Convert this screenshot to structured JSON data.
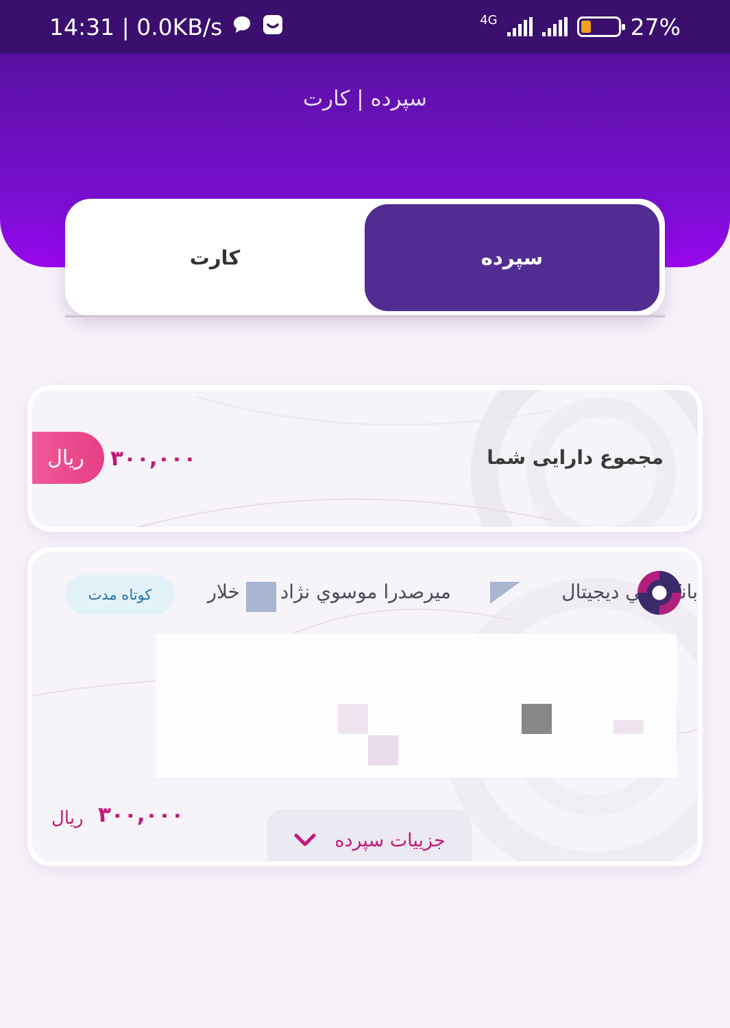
{
  "status_bar": {
    "time_speed": "14:31 | 0.0KB/s",
    "network_type": "4G",
    "battery_percent": "27%",
    "battery_level": 0.27
  },
  "header": {
    "title": "سپرده | کارت"
  },
  "tabs": [
    {
      "label": "سپرده",
      "active": true
    },
    {
      "label": "کارت",
      "active": false
    }
  ],
  "total_assets": {
    "label": "مجموع دارایی شما",
    "amount": "۳۰۰,۰۰۰",
    "currency": "ریال"
  },
  "deposit": {
    "bank_name": "بانک ملي ديجيتال",
    "owner_name": "ميرصدرا موسوي نژاد",
    "account_partial": "خلار",
    "type_badge": "کوتاه مدت",
    "amount": "۳۰۰,۰۰۰",
    "currency": "ریال",
    "details_label": "جزییات سپرده"
  },
  "colors": {
    "status_bar": "#3a0f6e",
    "header_top": "#5810a1",
    "header_bottom": "#9a07f0",
    "active_tab": "#512d92",
    "accent_pink": "#c2187a",
    "badge_bg": "#e3f2f9"
  }
}
